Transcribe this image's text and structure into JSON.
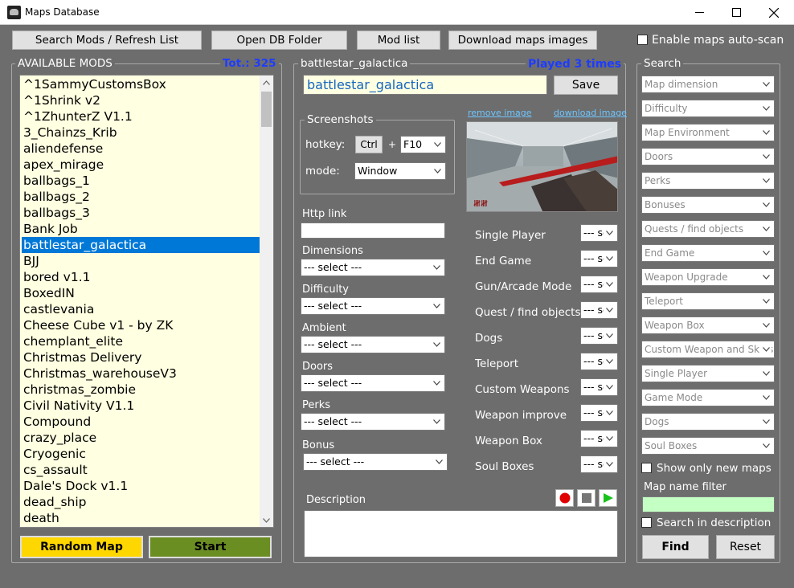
{
  "window": {
    "title": "Maps Database"
  },
  "toolbar": {
    "search_mods": "Search Mods / Refresh List",
    "open_db": "Open DB Folder",
    "mod_list": "Mod list",
    "download_images": "Download maps images",
    "auto_scan": "Enable maps auto-scan"
  },
  "mods": {
    "legend": "AVAILABLE MODS",
    "total": "Tot.: 325",
    "items": [
      "^1SammyCustomsBox",
      "^1Shrink v2",
      "^1ZhunterZ V1.1",
      "3_Chainzs_Krib",
      "aliendefense",
      "apex_mirage",
      "ballbags_1",
      "ballbags_2",
      "ballbags_3",
      "Bank Job",
      "battlestar_galactica",
      "BJJ",
      "bored v1.1",
      "BoxedIN",
      "castlevania",
      "Cheese Cube v1 - by ZK",
      "chemplant_elite",
      "Christmas Delivery",
      "Christmas_warehouseV3",
      "christmas_zombie",
      "Civil Nativity V1.1",
      "Compound",
      "crazy_place",
      "Cryogenic",
      "cs_assault",
      "Dale's Dock v1.1",
      "dead_ship",
      "death"
    ],
    "selected_index": 10,
    "random_btn": "Random Map",
    "start_btn": "Start",
    "random_color": "#ffd700",
    "start_color": "#6b8e23"
  },
  "detail": {
    "legend": "battlestar_galactica",
    "played": "Played 3 times",
    "name_value": "battlestar_galactica",
    "save": "Save",
    "screenshots": {
      "legend": "Screenshots",
      "hotkey_label": "hotkey:",
      "ctrl": "Ctrl",
      "plus": "+",
      "key": "F10",
      "mode_label": "mode:",
      "mode": "Window"
    },
    "remove_image": "remove image",
    "download_image": "download image",
    "http_link": "Http link",
    "fields": [
      {
        "label": "Dimensions",
        "value": "--- select ---"
      },
      {
        "label": "Difficulty",
        "value": "--- select ---"
      },
      {
        "label": "Ambient",
        "value": "--- select ---"
      },
      {
        "label": "Doors",
        "value": "--- select ---"
      },
      {
        "label": "Perks",
        "value": "--- select ---"
      },
      {
        "label": "Bonus",
        "value": "--- select ---"
      }
    ],
    "options": [
      {
        "label": "Single Player",
        "value": "--- se"
      },
      {
        "label": "End Game",
        "value": "--- se"
      },
      {
        "label": "Gun/Arcade Mode",
        "value": "--- se"
      },
      {
        "label": "Quest / find objects",
        "value": "--- se"
      },
      {
        "label": "Dogs",
        "value": "--- se"
      },
      {
        "label": "Teleport",
        "value": "--- se"
      },
      {
        "label": "Custom Weapons",
        "value": "--- se"
      },
      {
        "label": "Weapon improve",
        "value": "--- se"
      },
      {
        "label": "Weapon Box",
        "value": "--- se"
      },
      {
        "label": "Soul Boxes",
        "value": "--- se"
      }
    ],
    "description_label": "Description"
  },
  "search": {
    "legend": "Search",
    "filters": [
      "Map dimension",
      "Difficulty",
      "Map Environment",
      "Doors",
      "Perks",
      "Bonuses",
      "Quests / find objects",
      "End Game",
      "Weapon Upgrade",
      "Teleport",
      "Weapon Box",
      "Custom Weapon and Skins",
      "Single Player",
      "Game Mode",
      "Dogs",
      "Soul Boxes"
    ],
    "show_new": "Show only new maps",
    "name_filter_label": "Map name filter",
    "search_desc": "Search in description",
    "find": "Find",
    "reset": "Reset"
  }
}
